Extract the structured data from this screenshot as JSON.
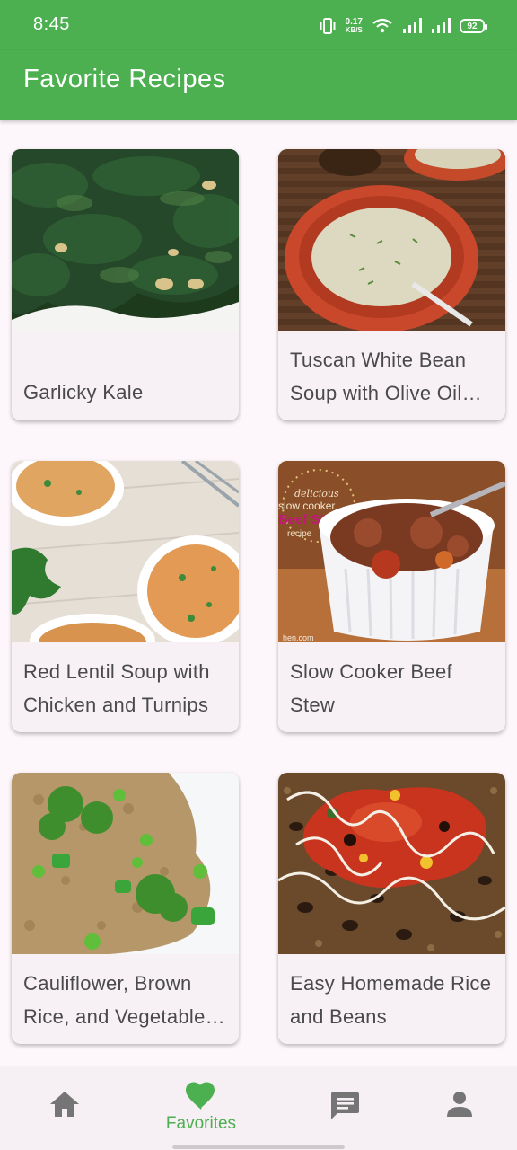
{
  "status_bar": {
    "time": "8:45",
    "net_speed": "0.17",
    "net_unit": "KB/S",
    "battery": "92"
  },
  "app_bar": {
    "title": "Favorite Recipes"
  },
  "recipes": [
    {
      "title": "Garlicky Kale"
    },
    {
      "title": "Tuscan White Bean Soup with Olive Oil and Rosemary"
    },
    {
      "title": "Red Lentil Soup with Chicken and Turnips"
    },
    {
      "title": "Slow Cooker Beef Stew"
    },
    {
      "title": "Cauliflower, Brown Rice, and Vegetable Fried Rice"
    },
    {
      "title": "Easy Homemade Rice and Beans"
    }
  ],
  "image_overlays": {
    "stew_line1": "delicious",
    "stew_line2": "slow cooker",
    "stew_line3": "Beef Stew",
    "stew_line4": "recipe",
    "stew_source": "hen.com"
  },
  "bottom_nav": {
    "active_label": "Favorites"
  },
  "colors": {
    "primary": "#4caf50",
    "background": "#fdf7fb",
    "card": "#f7f1f5",
    "nav_icon": "#757575"
  }
}
